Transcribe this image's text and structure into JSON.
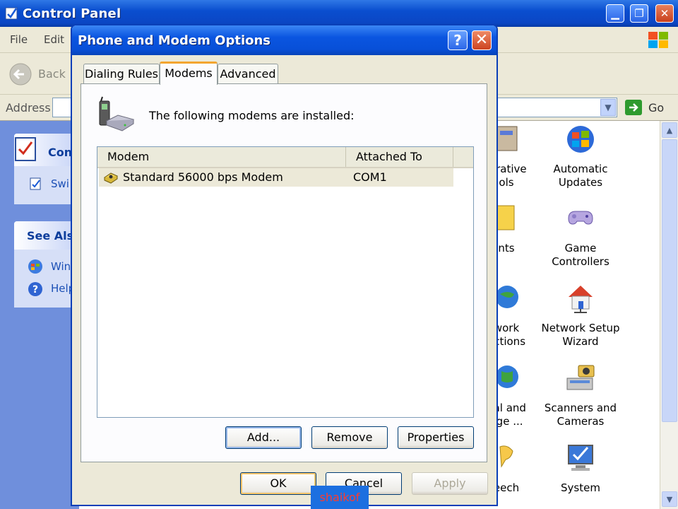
{
  "control_panel": {
    "title": "Control Panel",
    "menu": [
      "File",
      "Edit"
    ],
    "toolbar": {
      "back_label": "Back"
    },
    "address": {
      "label": "Address",
      "go_label": "Go"
    },
    "left_pane": {
      "header_title": "Con",
      "switch_label": "Swi",
      "see_also_title": "See Als",
      "see_also_items": [
        "Win",
        "Help"
      ]
    },
    "icons": [
      {
        "label": "strative\nols",
        "name": "administrative-tools-icon"
      },
      {
        "label": "Automatic\nUpdates",
        "name": "automatic-updates-icon"
      },
      {
        "label": "nts",
        "name": "fonts-icon"
      },
      {
        "label": "Game\nControllers",
        "name": "game-controllers-icon"
      },
      {
        "label": "work\nections",
        "name": "network-connections-icon"
      },
      {
        "label": "Network Setup\nWizard",
        "name": "network-setup-wizard-icon"
      },
      {
        "label": "nal and\nage ...",
        "name": "regional-options-icon"
      },
      {
        "label": "Scanners and\nCameras",
        "name": "scanners-cameras-icon"
      },
      {
        "label": "eech",
        "name": "speech-icon"
      },
      {
        "label": "System",
        "name": "system-icon"
      }
    ]
  },
  "dialog": {
    "title": "Phone and Modem Options",
    "help_glyph": "?",
    "close_glyph": "✕",
    "tabs": [
      {
        "label": "Dialing Rules",
        "active": false
      },
      {
        "label": "Modems",
        "active": true
      },
      {
        "label": "Advanced",
        "active": false
      }
    ],
    "installed_text": "The following modems are  installed:",
    "list": {
      "columns": [
        "Modem",
        "Attached To"
      ],
      "rows": [
        {
          "modem": "Standard 56000 bps Modem",
          "attached_to": "COM1"
        }
      ]
    },
    "buttons": {
      "add": "Add...",
      "remove": "Remove",
      "properties": "Properties"
    },
    "footer": {
      "ok": "OK",
      "cancel": "Cancel",
      "apply": "Apply"
    }
  },
  "watermark": "shaikof",
  "colors": {
    "title_blue": "#0a55e0",
    "dialog_face": "#ece9d8",
    "tab_accent": "#f3a530"
  }
}
